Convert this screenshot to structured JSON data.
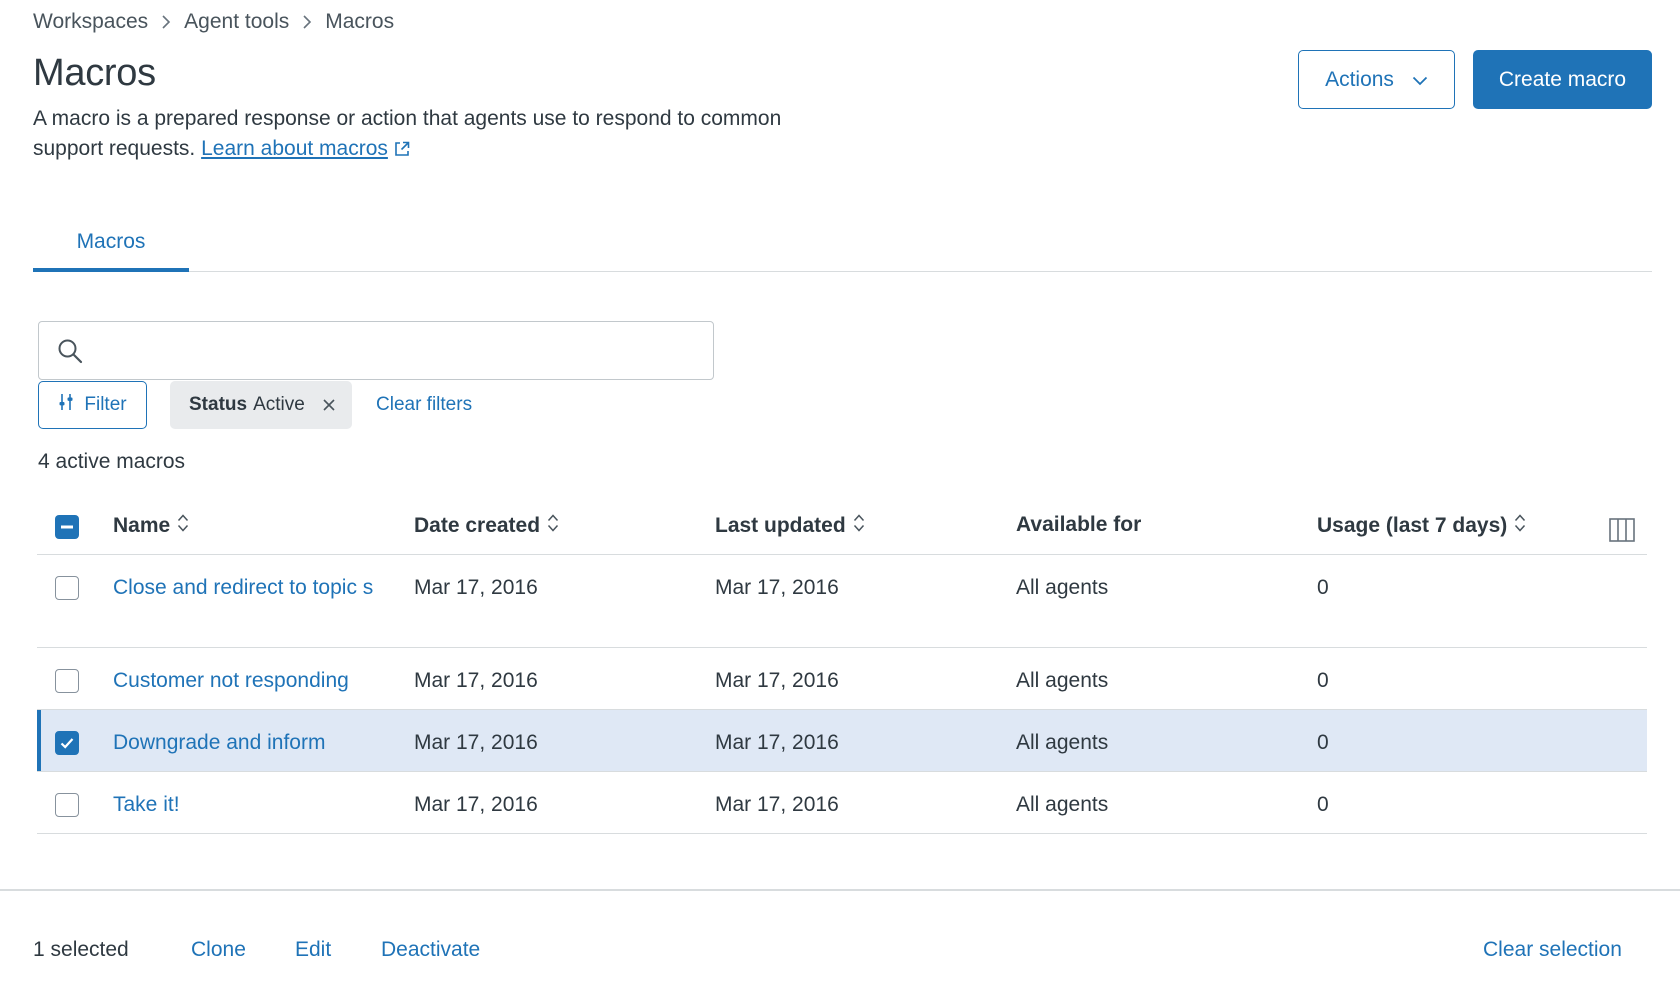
{
  "breadcrumb": [
    "Workspaces",
    "Agent tools",
    "Macros"
  ],
  "page": {
    "title": "Macros",
    "description": "A macro is a prepared response or action that agents use to respond to common support requests.",
    "learn_link": "Learn about macros"
  },
  "header_buttons": {
    "actions": "Actions",
    "create": "Create macro"
  },
  "tabs": [
    {
      "label": "Macros",
      "active": true
    }
  ],
  "search": {
    "value": "",
    "placeholder": ""
  },
  "filters": {
    "filter_button": "Filter",
    "chip_key": "Status",
    "chip_value": "Active",
    "clear_filters": "Clear filters"
  },
  "count_label": "4 active macros",
  "table": {
    "columns": [
      "Name",
      "Date created",
      "Last updated",
      "Available for",
      "Usage (last 7 days)"
    ],
    "rows": [
      {
        "name": "Close and redirect to topic s",
        "date_created": "Mar 17, 2016",
        "last_updated": "Mar 17, 2016",
        "available_for": "All agents",
        "usage": "0",
        "selected": false
      },
      {
        "name": "Customer not responding",
        "date_created": "Mar 17, 2016",
        "last_updated": "Mar 17, 2016",
        "available_for": "All agents",
        "usage": "0",
        "selected": false
      },
      {
        "name": "Downgrade and inform",
        "date_created": "Mar 17, 2016",
        "last_updated": "Mar 17, 2016",
        "available_for": "All agents",
        "usage": "0",
        "selected": true
      },
      {
        "name": "Take it!",
        "date_created": "Mar 17, 2016",
        "last_updated": "Mar 17, 2016",
        "available_for": "All agents",
        "usage": "0",
        "selected": false
      }
    ]
  },
  "footer": {
    "selected_count": "1 selected",
    "clone": "Clone",
    "edit": "Edit",
    "deactivate": "Deactivate",
    "clear_selection": "Clear selection"
  },
  "icons": {
    "breadcrumb_separator": "chevron-right-icon",
    "external_link": "external-link-icon",
    "actions_dropdown": "chevron-down-icon",
    "search": "search-icon",
    "filter": "filter-sliders-icon",
    "chip_remove": "close-icon",
    "sort": "sort-icon",
    "columns": "columns-icon"
  },
  "colors": {
    "accent": "#1f73b7",
    "selected_row": "#dfe8f5",
    "text": "#2f3941",
    "border": "#d8dcde"
  }
}
